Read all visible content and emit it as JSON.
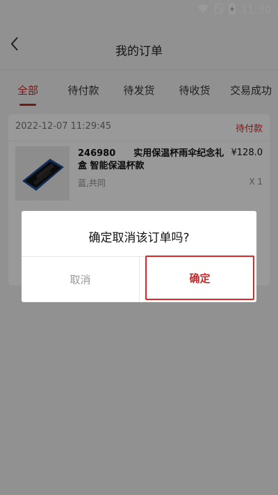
{
  "status_bar": {
    "time": "11:30"
  },
  "header": {
    "title": "我的订单"
  },
  "tabs": [
    {
      "label": "全部",
      "active": true
    },
    {
      "label": "待付款",
      "active": false
    },
    {
      "label": "待发货",
      "active": false
    },
    {
      "label": "待收货",
      "active": false
    },
    {
      "label": "交易成功",
      "active": false
    }
  ],
  "order": {
    "time": "2022-12-07 11:29:45",
    "status": "待付款",
    "product": {
      "title": "246980　　实用保温杯雨伞纪念礼盒 智能保温杯款",
      "price": "¥128.0",
      "spec": "蓝,共同",
      "qty": "X 1"
    }
  },
  "dialog": {
    "message": "确定取消该订单吗?",
    "cancel_label": "取消",
    "confirm_label": "确定"
  },
  "colors": {
    "accent": "#c62828",
    "highlight": "#e02525"
  }
}
